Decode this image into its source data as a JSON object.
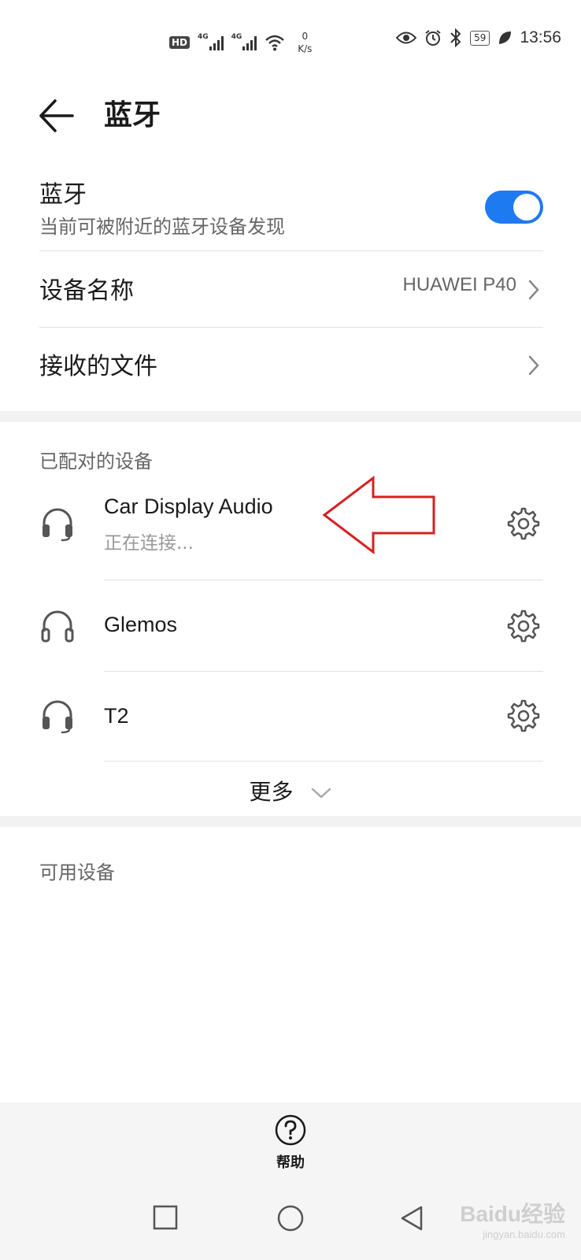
{
  "status_bar": {
    "left_badge": "HD",
    "net_label_1": "4G",
    "net_label_2": "4G",
    "speed_value": "0",
    "speed_unit": "K/s",
    "battery": "59",
    "time": "13:56",
    "icons": [
      "eye-icon",
      "alarm-icon",
      "bluetooth-icon",
      "leaf-icon"
    ]
  },
  "header": {
    "title": "蓝牙"
  },
  "bluetooth_toggle": {
    "label": "蓝牙",
    "description": "当前可被附近的蓝牙设备发现",
    "enabled": true,
    "accent_color": "#1e7af0"
  },
  "device_name_row": {
    "label": "设备名称",
    "value": "HUAWEI P40"
  },
  "received_files_row": {
    "label": "接收的文件"
  },
  "paired_section": {
    "heading": "已配对的设备",
    "devices": [
      {
        "name": "Car Display Audio",
        "status": "正在连接..."
      },
      {
        "name": "Glemos",
        "status": ""
      },
      {
        "name": "T2",
        "status": ""
      }
    ],
    "more_label": "更多"
  },
  "available_section": {
    "heading": "可用设备"
  },
  "help": {
    "label": "帮助"
  },
  "watermark": {
    "text": "Baidu经验",
    "sub": "jingyan.baidu.com"
  }
}
